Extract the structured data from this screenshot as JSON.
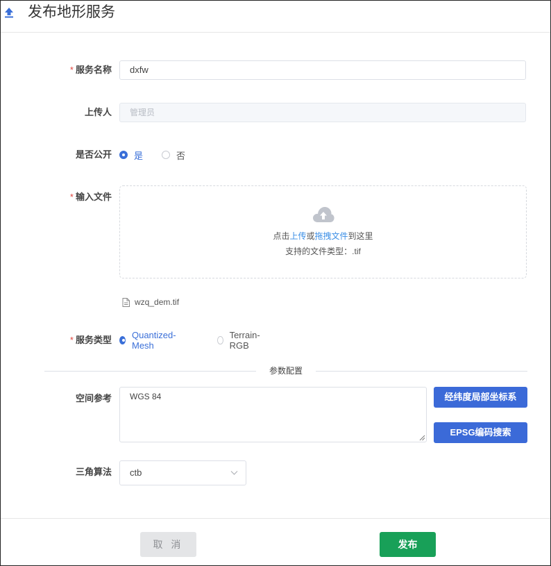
{
  "header": {
    "title": "发布地形服务",
    "icon": "upload-arrow-icon"
  },
  "form": {
    "service_name": {
      "label": "服务名称",
      "required": true,
      "value": "dxfw"
    },
    "uploader": {
      "label": "上传人",
      "placeholder": "管理员"
    },
    "is_public": {
      "label": "是否公开",
      "options": [
        {
          "label": "是",
          "checked": true
        },
        {
          "label": "否",
          "checked": false
        }
      ]
    },
    "input_file": {
      "label": "输入文件",
      "required": true,
      "hint_prefix": "点击",
      "hint_upload": "上传",
      "hint_or": "或",
      "hint_drag": "拖拽文件",
      "hint_suffix": "到这里",
      "supported_types": "支持的文件类型：.tif",
      "uploaded_file": "wzq_dem.tif"
    },
    "service_type": {
      "label": "服务类型",
      "required": true,
      "options": [
        {
          "label": "Quantized-Mesh",
          "checked": true
        },
        {
          "label": "Terrain-RGB",
          "checked": false
        }
      ]
    },
    "divider_label": "参数配置",
    "spatial_reference": {
      "label": "空间参考",
      "value": "WGS 84",
      "btn_local": "经纬度局部坐标系",
      "btn_epsg": "EPSG编码搜索"
    },
    "triangulation": {
      "label": "三角算法",
      "value": "ctb"
    }
  },
  "footer": {
    "cancel_label": "取 消",
    "publish_label": "发布"
  },
  "colors": {
    "accent": "#3a6fd8",
    "required": "#e0463f",
    "publish": "#18a058",
    "cancel_bg": "#e4e5e7"
  }
}
